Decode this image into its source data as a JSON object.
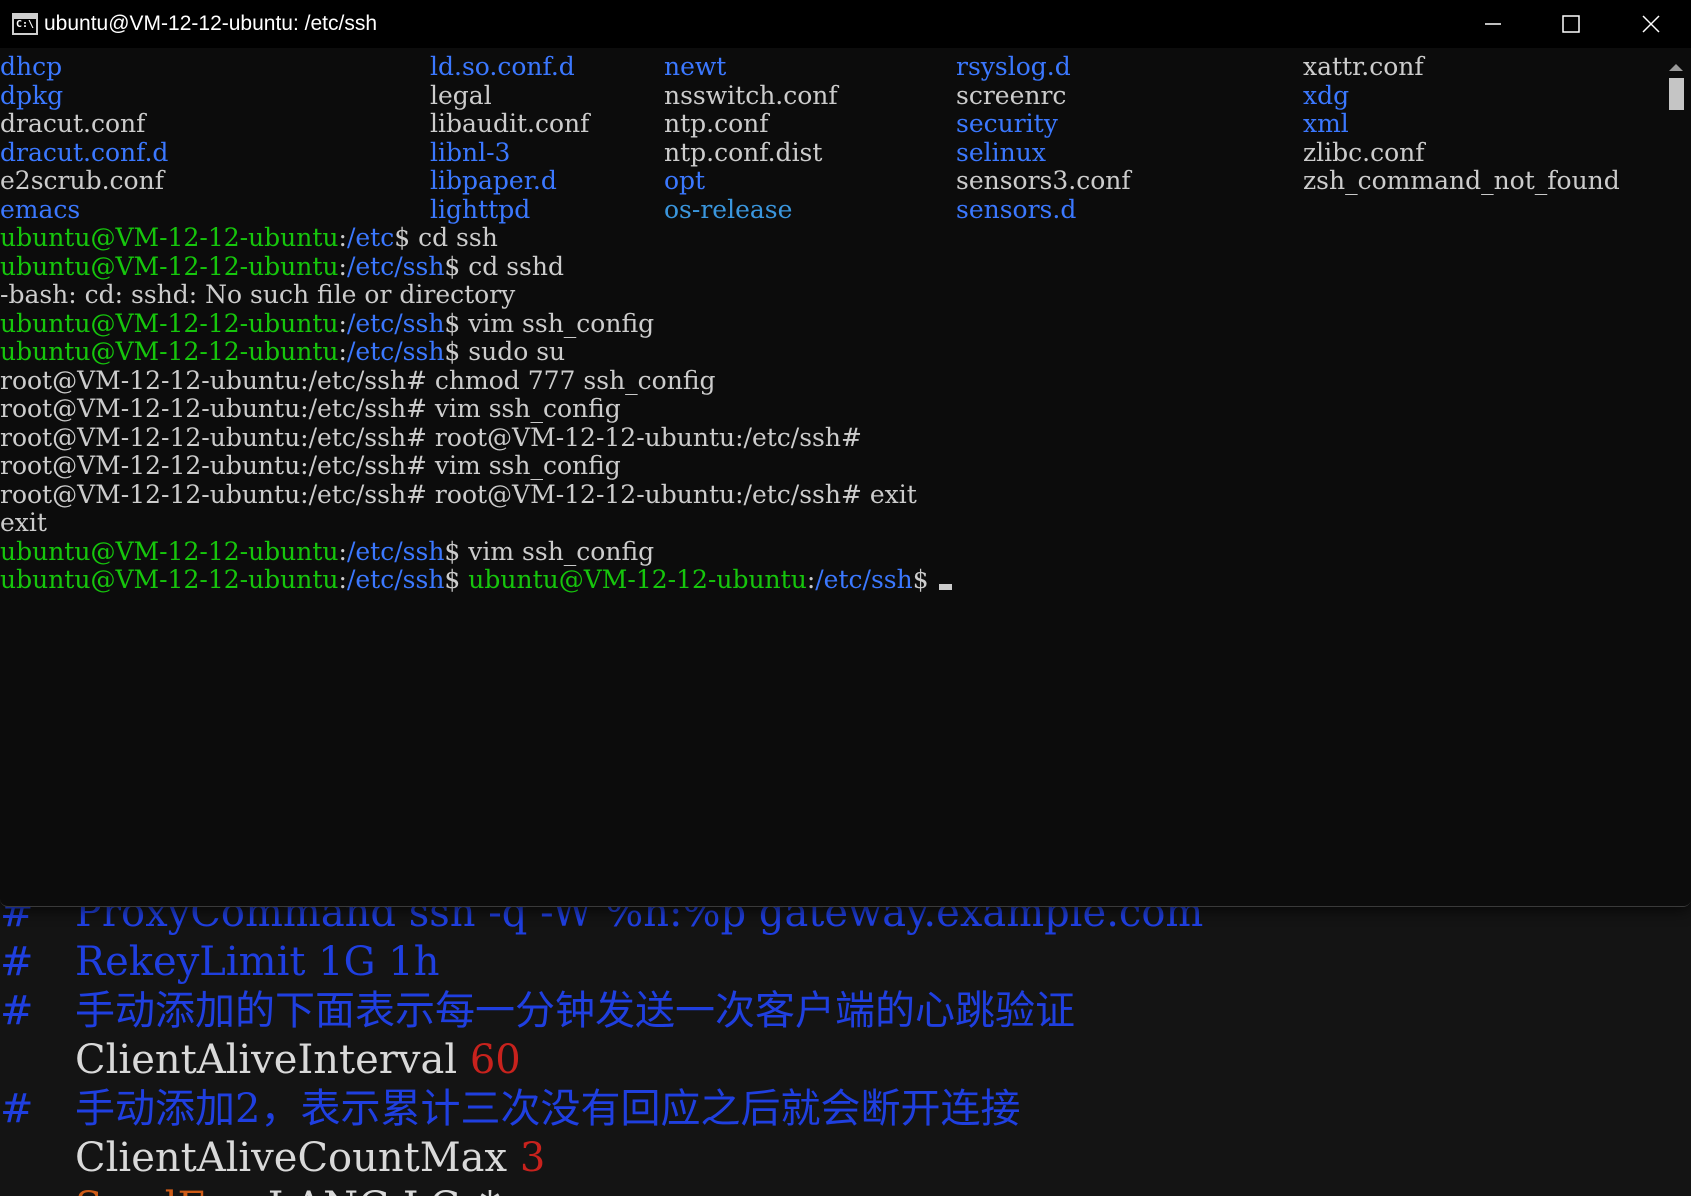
{
  "window": {
    "title": "ubuntu@VM-12-12-ubuntu: /etc/ssh",
    "app_icon_text": "C:\\",
    "icons": {
      "minimize": "minimize-icon",
      "maximize": "maximize-icon",
      "close": "close-icon"
    }
  },
  "terminal": {
    "listing": [
      [
        "dhcp",
        "ld.so.conf.d",
        "newt",
        "rsyslog.d",
        "xattr.conf"
      ],
      [
        "dpkg",
        "legal",
        "nsswitch.conf",
        "screenrc",
        "xdg"
      ],
      [
        "dracut.conf",
        "libaudit.conf",
        "ntp.conf",
        "security",
        "xml"
      ],
      [
        "dracut.conf.d",
        "libnl-3",
        "ntp.conf.dist",
        "selinux",
        "zlibc.conf"
      ],
      [
        "e2scrub.conf",
        "libpaper.d",
        "opt",
        "sensors3.conf",
        "zsh_command_not_found"
      ],
      [
        "emacs",
        "lighttpd",
        "os-release",
        "sensors.d",
        ""
      ]
    ],
    "listing_colors": [
      [
        "blue",
        "blue",
        "blue",
        "blue",
        "white"
      ],
      [
        "blue",
        "white",
        "white",
        "white",
        "blue"
      ],
      [
        "white",
        "white",
        "white",
        "blue",
        "blue"
      ],
      [
        "blue",
        "blue",
        "white",
        "blue",
        "white"
      ],
      [
        "white",
        "blue",
        "blue",
        "white",
        "white"
      ],
      [
        "blue",
        "blue",
        "teal",
        "blue",
        "white"
      ]
    ],
    "lines": [
      {
        "user": "ubuntu@VM-12-12-ubuntu",
        "sep": ":",
        "path": "/etc",
        "sym": "$",
        "cmd": " cd ssh"
      },
      {
        "user": "ubuntu@VM-12-12-ubuntu",
        "sep": ":",
        "path": "/etc/ssh",
        "sym": "$",
        "cmd": " cd sshd"
      },
      {
        "plain": "-bash: cd: sshd: No such file or directory"
      },
      {
        "user": "ubuntu@VM-12-12-ubuntu",
        "sep": ":",
        "path": "/etc/ssh",
        "sym": "$",
        "cmd": " vim ssh_config"
      },
      {
        "user": "ubuntu@VM-12-12-ubuntu",
        "sep": ":",
        "path": "/etc/ssh",
        "sym": "$",
        "cmd": " sudo su"
      },
      {
        "plain": "root@VM-12-12-ubuntu:/etc/ssh# chmod 777 ssh_config"
      },
      {
        "plain": "root@VM-12-12-ubuntu:/etc/ssh# vim ssh_config"
      },
      {
        "plain": "root@VM-12-12-ubuntu:/etc/ssh# root@VM-12-12-ubuntu:/etc/ssh#"
      },
      {
        "plain": "root@VM-12-12-ubuntu:/etc/ssh# vim ssh_config"
      },
      {
        "plain": "root@VM-12-12-ubuntu:/etc/ssh# root@VM-12-12-ubuntu:/etc/ssh# exit"
      },
      {
        "plain": "exit"
      },
      {
        "user": "ubuntu@VM-12-12-ubuntu",
        "sep": ":",
        "path": "/etc/ssh",
        "sym": "$",
        "cmd": " vim ssh_config"
      }
    ],
    "last_line": {
      "user": "ubuntu@VM-12-12-ubuntu",
      "sep": ":",
      "path": "/etc/ssh",
      "sym": "$ ",
      "user2": "ubuntu@VM-12-12-ubuntu",
      "sep2": ":",
      "path2": "/etc/ssh",
      "sym2": "$ "
    }
  },
  "background_vim": {
    "lines": [
      {
        "gutter": "#",
        "code": "ProxyCommand ssh -q -W %h:%p gateway.example.com",
        "color": "blue"
      },
      {
        "gutter": "#",
        "code": "RekeyLimit 1G 1h",
        "color": "blue"
      },
      {
        "gutter": "#",
        "code": "手动添加的下面表示每一分钟发送一次客户端的心跳验证",
        "color": "blue"
      },
      {
        "gutter": "",
        "code": "ClientAliveInterval ",
        "value": "60",
        "color": "white"
      },
      {
        "gutter": "#",
        "code": "手动添加2，表示累计三次没有回应之后就会断开连接",
        "color": "blue"
      },
      {
        "gutter": "",
        "code": "ClientAliveCountMax ",
        "value": "3",
        "color": "white"
      },
      {
        "gutter": "",
        "code": "SendEnv",
        "rest": " LANG LC_*",
        "color": "orange"
      }
    ]
  },
  "colors": {
    "green": "#16c60c",
    "blue": "#3b78ff",
    "white": "#cccccc",
    "teal": "#3a96dd",
    "vim_blue": "#1f3fe0",
    "vim_red": "#c8221d",
    "vim_orange": "#cf5c17"
  }
}
